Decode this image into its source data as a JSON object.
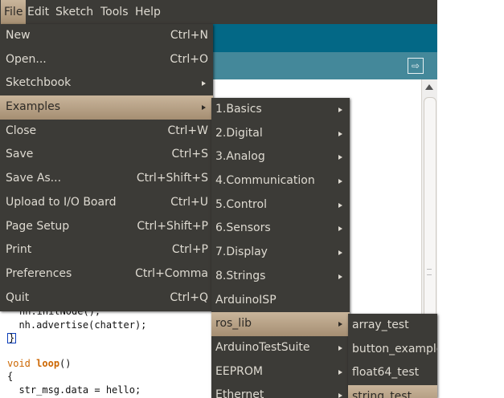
{
  "menubar": {
    "items": [
      {
        "label": "File"
      },
      {
        "label": "Edit"
      },
      {
        "label": "Sketch"
      },
      {
        "label": "Tools"
      },
      {
        "label": "Help"
      }
    ]
  },
  "toolbar": {
    "serial_monitor_icon": "serial-monitor-icon"
  },
  "editor": {
    "lines": [
      "nh.initNode();",
      "  nh.advertise(chatter);",
      "}",
      "",
      "void loop()",
      "{",
      "  str_msg.data = hello;"
    ],
    "keyword_void": "void",
    "keyword_loop": "loop",
    "loop_rest": "()"
  },
  "file_menu": {
    "items": [
      {
        "label": "New",
        "shortcut": "Ctrl+N"
      },
      {
        "label": "Open...",
        "shortcut": "Ctrl+O"
      },
      {
        "label": "Sketchbook",
        "shortcut": ""
      },
      {
        "label": "Examples",
        "shortcut": ""
      },
      {
        "label": "Close",
        "shortcut": "Ctrl+W"
      },
      {
        "label": "Save",
        "shortcut": "Ctrl+S"
      },
      {
        "label": "Save As...",
        "shortcut": "Ctrl+Shift+S"
      },
      {
        "label": "Upload to I/O Board",
        "shortcut": "Ctrl+U"
      },
      {
        "label": "Page Setup",
        "shortcut": "Ctrl+Shift+P"
      },
      {
        "label": "Print",
        "shortcut": "Ctrl+P"
      },
      {
        "label": "Preferences",
        "shortcut": "Ctrl+Comma"
      },
      {
        "label": "Quit",
        "shortcut": "Ctrl+Q"
      }
    ]
  },
  "examples_menu": {
    "items": [
      {
        "label": "1.Basics"
      },
      {
        "label": "2.Digital"
      },
      {
        "label": "3.Analog"
      },
      {
        "label": "4.Communication"
      },
      {
        "label": "5.Control"
      },
      {
        "label": "6.Sensors"
      },
      {
        "label": "7.Display"
      },
      {
        "label": "8.Strings"
      },
      {
        "label": "ArduinoISP"
      },
      {
        "label": "ros_lib"
      },
      {
        "label": "ArduinoTestSuite"
      },
      {
        "label": "EEPROM"
      },
      {
        "label": "Ethernet"
      }
    ]
  },
  "roslib_menu": {
    "items": [
      {
        "label": "array_test"
      },
      {
        "label": "button_example"
      },
      {
        "label": "float64_test"
      },
      {
        "label": "string_test"
      }
    ]
  }
}
